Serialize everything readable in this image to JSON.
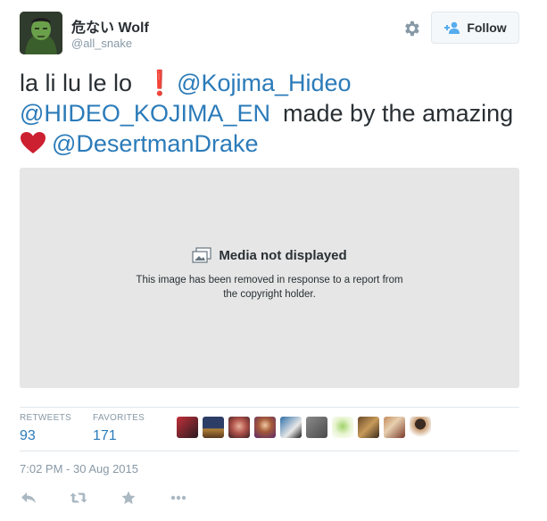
{
  "user": {
    "display_name": "危ない Wolf",
    "handle": "@all_snake",
    "avatar_icon": "hulk-avatar"
  },
  "header": {
    "follow_label": "Follow",
    "settings_icon": "gear-icon"
  },
  "tweet": {
    "text_part1": "la li lu le lo",
    "exclamation": "❗",
    "mention1": "@Kojima_Hideo",
    "mention2": "@HIDEO_KOJIMA_EN",
    "text_part2": "made by the amazing",
    "mention3": "@DesertmanDrake",
    "heart_color": "#cc1f2f",
    "mention_color": "#2b7bb9"
  },
  "media": {
    "title": "Media not displayed",
    "description": "This image has been removed in response to a report from the copyright holder."
  },
  "stats": {
    "retweets_label": "RETWEETS",
    "retweets_value": "93",
    "favorites_label": "FAVORITES",
    "favorites_value": "171"
  },
  "timestamp": "7:02 PM - 30 Aug 2015",
  "actions": [
    "reply-icon",
    "retweet-icon",
    "favorite-icon",
    "more-icon"
  ]
}
